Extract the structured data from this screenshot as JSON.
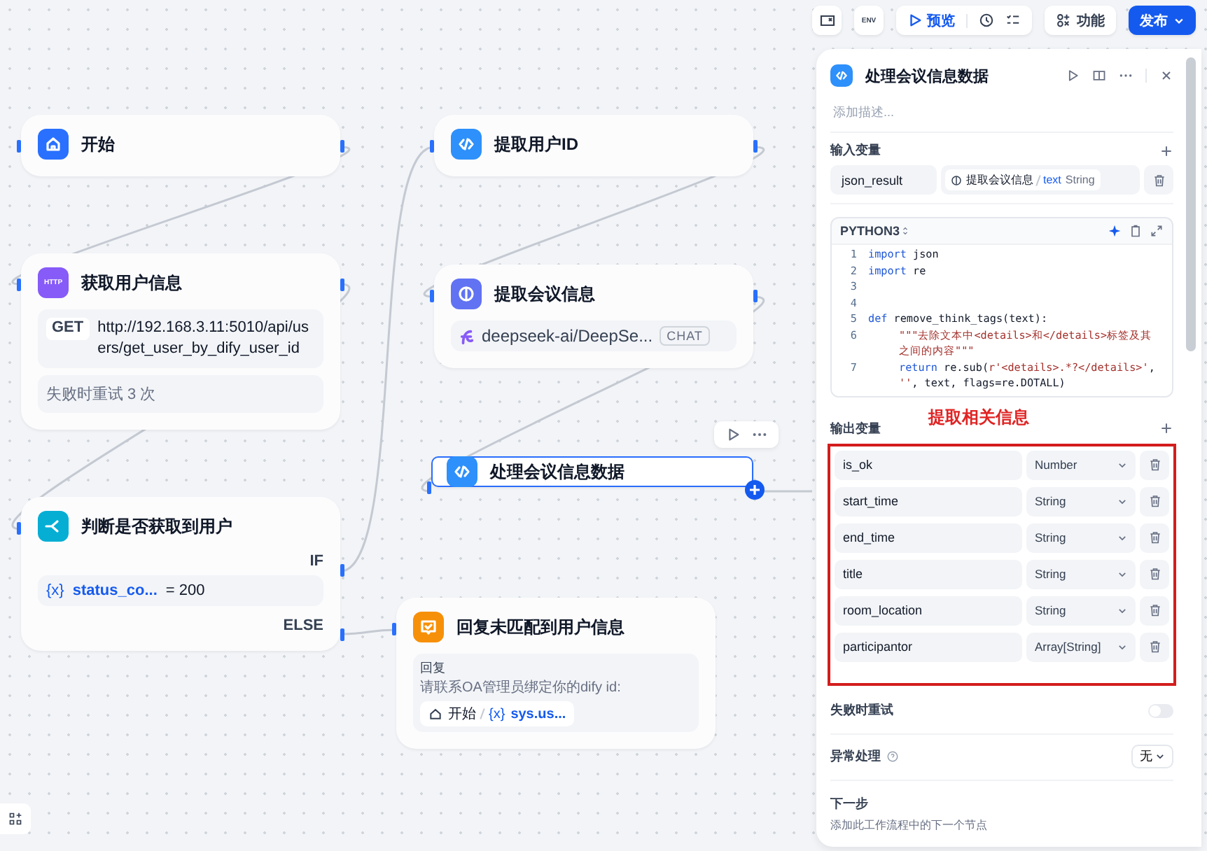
{
  "toolbar": {
    "env_label": "ENV",
    "preview_label": "预览",
    "features_label": "功能",
    "publish_label": "发布"
  },
  "nodes": [
    {
      "kind": "start",
      "title": "开始",
      "selected": false
    },
    {
      "kind": "http",
      "title": "获取用户信息",
      "icon_text": "HTTP",
      "method": "GET",
      "url": "http://192.168.3.11:5010/api/users/get_user_by_dify_user_id",
      "retry": "失败时重试 3 次",
      "selected": false
    },
    {
      "kind": "if",
      "title": "判断是否获取到用户",
      "if_label": "IF",
      "var_icon": "{x}",
      "variable": "status_co...",
      "condition": "= 200",
      "else_label": "ELSE",
      "selected": false
    },
    {
      "kind": "code",
      "title": "提取用户ID",
      "selected": false
    },
    {
      "kind": "llm",
      "title": "提取会议信息",
      "model": "deepseek-ai/DeepSe...",
      "mode": "CHAT",
      "selected": false
    },
    {
      "kind": "code",
      "title": "处理会议信息数据",
      "selected": true
    },
    {
      "kind": "answer",
      "title": "回复未匹配到用户信息",
      "label": "回复",
      "text": "请联系OA管理员绑定你的dify id:",
      "ref_node": "开始",
      "ref_var_icon": "{x}",
      "ref_var": "sys.us...",
      "selected": false
    }
  ],
  "panel": {
    "title": "处理会议信息数据",
    "description_placeholder": "添加描述...",
    "input_section": "输入变量",
    "inputs": [
      {
        "name": "json_result",
        "source_node": "提取会议信息",
        "source_var": "text",
        "source_type": "String"
      }
    ],
    "code": {
      "language": "PYTHON3",
      "lines": [
        {
          "number": "1",
          "segments": [
            {
              "text": "import",
              "kind": "keyword"
            },
            {
              "text": " json",
              "kind": "plain"
            }
          ]
        },
        {
          "number": "2",
          "segments": [
            {
              "text": "import",
              "kind": "keyword"
            },
            {
              "text": " re",
              "kind": "plain"
            }
          ]
        },
        {
          "number": "3"
        },
        {
          "number": "4"
        },
        {
          "number": "5",
          "segments": [
            {
              "text": "def",
              "kind": "keyword"
            },
            {
              "text": " remove_think_tags(text):",
              "kind": "plain"
            }
          ]
        },
        {
          "number": "6",
          "kind": "nested",
          "segments": [
            {
              "text": "\"\"\"去除文本中<details>和</details>标签及其之间的内容\"\"\"",
              "kind": "string"
            }
          ]
        },
        {
          "number": "7",
          "kind": "nested",
          "segments": [
            {
              "text": "return",
              "kind": "keyword"
            },
            {
              "text": " re.sub(",
              "kind": "plain"
            },
            {
              "text": "r'<details>.*?</details>'",
              "kind": "string"
            },
            {
              "text": ", ",
              "kind": "plain"
            },
            {
              "text": "''",
              "kind": "string"
            },
            {
              "text": ", text, flags=re.DOTALL)",
              "kind": "plain"
            }
          ]
        }
      ]
    },
    "annotation": "提取相关信息",
    "output_section": "输出变量",
    "outputs": [
      {
        "name": "is_ok",
        "type": "Number"
      },
      {
        "name": "start_time",
        "type": "String"
      },
      {
        "name": "end_time",
        "type": "String"
      },
      {
        "name": "title",
        "type": "String"
      },
      {
        "name": "room_location",
        "type": "String"
      },
      {
        "name": "participantor",
        "type": "Array[String]"
      }
    ],
    "retry": {
      "label": "失败时重试",
      "on": false
    },
    "error_handling": {
      "label": "异常处理",
      "value": "无"
    },
    "next_step": {
      "title": "下一步",
      "description": "添加此工作流程中的下一个节点"
    }
  }
}
